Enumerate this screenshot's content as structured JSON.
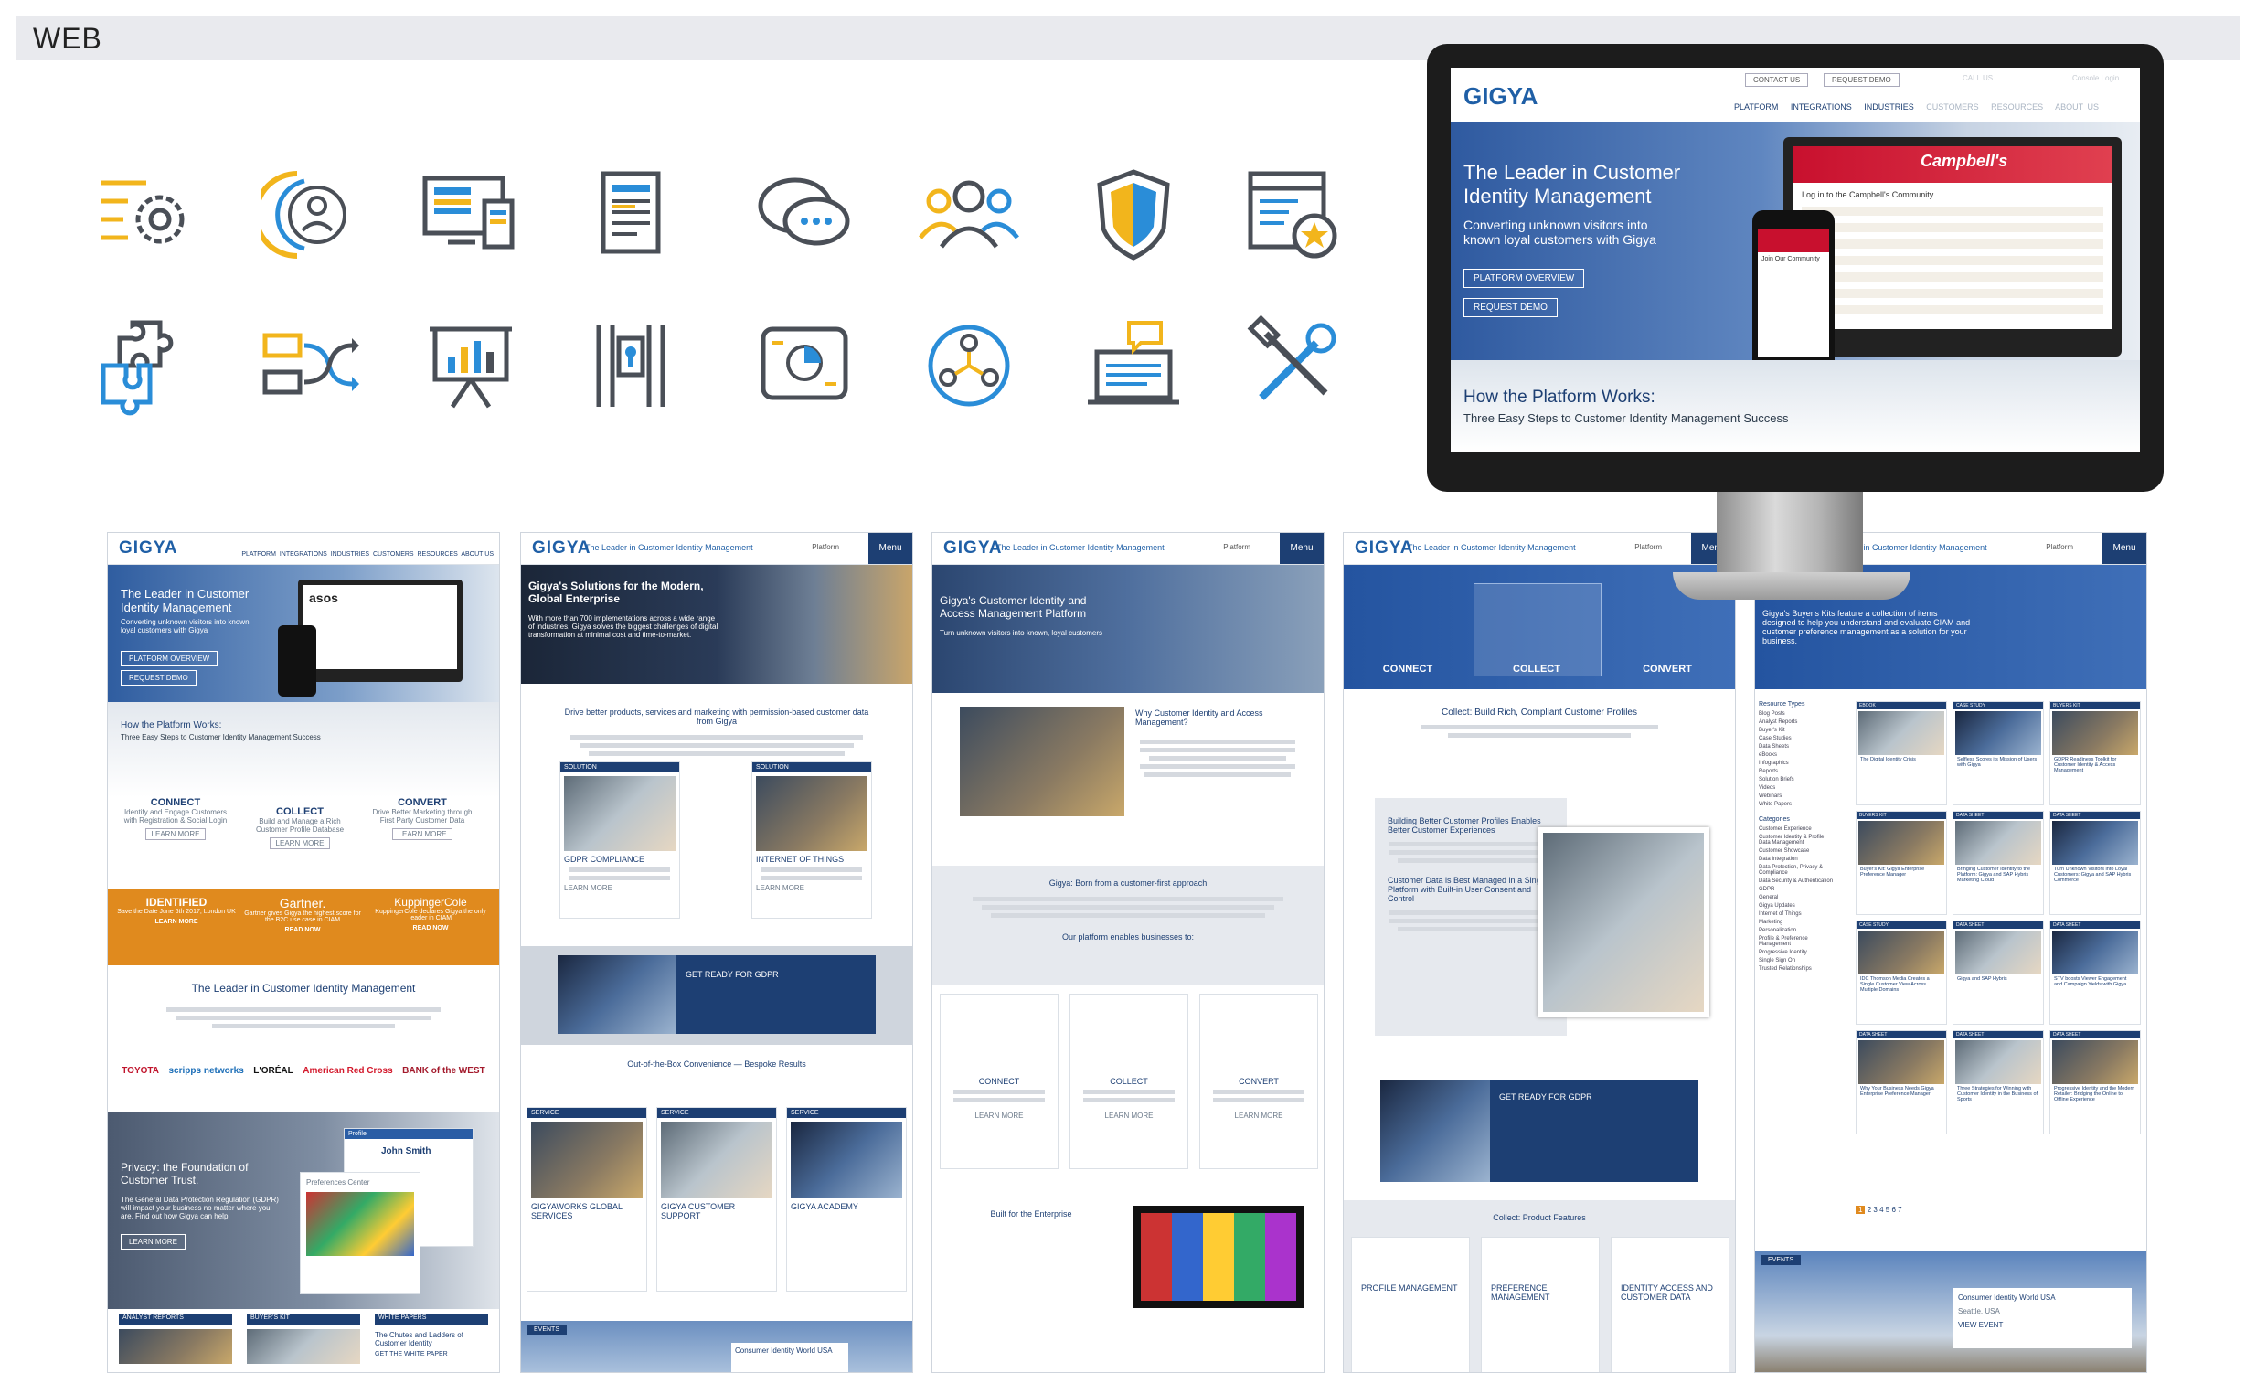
{
  "section_label": "WEB",
  "icons": [
    "settings-lines-icon",
    "user-profile-icon",
    "devices-icon",
    "document-list-icon",
    "chat-bubbles-icon",
    "team-users-icon",
    "shield-icon",
    "browser-star-icon",
    "puzzle-icon",
    "workflow-shuffle-icon",
    "presentation-chart-icon",
    "vault-lock-icon",
    "dashboard-pie-icon",
    "group-network-icon",
    "laptop-chat-icon",
    "tools-icon"
  ],
  "colors": {
    "brand_blue": "#1d3f73",
    "accent_orange": "#e08a1e",
    "icon_gray": "#4a4f57",
    "icon_yellow": "#f2b51c",
    "icon_blue": "#2a8dd8"
  },
  "monitor": {
    "logo": "GIGYA",
    "nav": [
      "PLATFORM",
      "INTEGRATIONS",
      "INDUSTRIES",
      "CUSTOMERS",
      "RESOURCES",
      "ABOUT US"
    ],
    "top_buttons": [
      "CONTACT US",
      "REQUEST DEMO"
    ],
    "call": "CALL US",
    "login": "Console Login",
    "hero_title": "The Leader in Customer Identity Management",
    "hero_sub": "Converting unknown visitors into known loyal customers with Gigya",
    "btn_overview": "PLATFORM OVERVIEW",
    "btn_demo": "REQUEST DEMO",
    "campbells_title": "Log in to the Campbell's Community",
    "phone_text": "Join Our Community",
    "how_title": "How the Platform Works:",
    "how_sub": "Three Easy Steps to Customer Identity Management Success"
  },
  "col1": {
    "logo": "GIGYA",
    "nav": [
      "PLATFORM",
      "INTEGRATIONS",
      "INDUSTRIES",
      "CUSTOMERS",
      "RESOURCES",
      "ABOUT US"
    ],
    "hero_title": "The Leader in Customer Identity Management",
    "hero_sub": "Converting unknown visitors into known loyal customers with Gigya",
    "btn1": "PLATFORM OVERVIEW",
    "btn2": "REQUEST DEMO",
    "asos": "asos",
    "how_title": "How the Platform Works:",
    "how_sub": "Three Easy Steps to Customer Identity Management Success",
    "steps": [
      {
        "title": "CONNECT",
        "text": "Identify and Engage Customers with Registration & Social Login"
      },
      {
        "title": "COLLECT",
        "text": "Build and Manage a Rich Customer Profile Database"
      },
      {
        "title": "CONVERT",
        "text": "Drive Better Marketing through First Party Customer Data"
      }
    ],
    "learn_more": "LEARN MORE",
    "awards": [
      {
        "title": "IDENTIFIED",
        "text": "Save the Date June 6th 2017, London UK",
        "link": "LEARN MORE"
      },
      {
        "title": "Gartner.",
        "text": "Gartner gives Gigya the highest score for the B2C use case in CIAM",
        "link": "READ NOW"
      },
      {
        "title": "KuppingerCole",
        "text": "KuppingerCole declares Gigya the only leader in CIAM",
        "link": "READ NOW"
      }
    ],
    "leader_title": "The Leader in Customer Identity Management",
    "clients": [
      "TOYOTA",
      "scripps networks",
      "L'ORÉAL",
      "American Red Cross",
      "BANK of the WEST"
    ],
    "privacy_title": "Privacy: the Foundation of Customer Trust.",
    "privacy_text": "The General Data Protection Regulation (GDPR) will impact your business no matter where you are. Find out how Gigya can help.",
    "profile_name": "John Smith",
    "profile_label": "Profile",
    "pref_label": "Preferences Center",
    "footer_tabs": [
      "ANALYST REPORTS",
      "BUYER'S KIT",
      "WHITE PAPERS"
    ],
    "wp_title": "The Chutes and Ladders of Customer Identity",
    "wp_link": "GET THE WHITE PAPER"
  },
  "col2": {
    "tag": "The Leader in Customer Identity Management",
    "platform": "Platform",
    "menu": "Menu",
    "hero_title": "Gigya's Solutions for the Modern, Global Enterprise",
    "hero_text": "With more than 700 implementations across a wide range of industries, Gigya solves the biggest challenges of digital transformation at minimal cost and time-to-market.",
    "drive_title": "Drive better products, services and marketing with permission-based customer data from Gigya",
    "sol_label": "SOLUTION",
    "sol1": "GDPR COMPLIANCE",
    "sol2": "INTERNET OF THINGS",
    "learn_more": "LEARN MORE",
    "gdpr_title": "GET READY FOR GDPR",
    "box_title": "Out-of-the-Box Convenience — Bespoke Results",
    "svc_label": "SERVICE",
    "services": [
      "GIGYAWORKS GLOBAL SERVICES",
      "GIGYA CUSTOMER SUPPORT",
      "GIGYA ACADEMY"
    ],
    "events": "EVENTS",
    "event_name": "Consumer Identity World USA"
  },
  "col3": {
    "tag": "The Leader in Customer Identity Management",
    "platform": "Platform",
    "menu": "Menu",
    "hero_title": "Gigya's Customer Identity and Access Management Platform",
    "hero_sub": "Turn unknown visitors into known, loyal customers",
    "why_title": "Why Customer Identity and Access Management?",
    "born_title": "Gigya: Born from a customer-first approach",
    "enables": "Our platform enables businesses to:",
    "features": [
      "CONNECT",
      "COLLECT",
      "CONVERT"
    ],
    "learn_more": "LEARN MORE",
    "built_title": "Built for the Enterprise"
  },
  "col4": {
    "tag": "The Leader in Customer Identity Management",
    "platform": "Platform",
    "menu": "Menu",
    "tabs": [
      "CONNECT",
      "COLLECT",
      "CONVERT"
    ],
    "collect_title": "Collect: Build Rich, Compliant Customer Profiles",
    "side1": "Building Better Customer Profiles Enables Better Customer Experiences",
    "side2": "Customer Data is Best Managed in a Single Platform with Built-in User Consent and Control",
    "gdpr_title": "GET READY FOR GDPR",
    "features_title": "Collect: Product Features",
    "features": [
      "PROFILE MANAGEMENT",
      "PREFERENCE MANAGEMENT",
      "IDENTITY ACCESS AND CUSTOMER DATA"
    ]
  },
  "col5": {
    "tag": "The Leader in Customer Identity Management",
    "platform": "Platform",
    "menu": "Menu",
    "hero_text": "Gigya's Buyer's Kits feature a collection of items designed to help you understand and evaluate CIAM and customer preference management as a solution for your business.",
    "filter_title": "Resource Types",
    "filters": [
      "Blog Posts",
      "Analyst Reports",
      "Buyer's Kit",
      "Case Studies",
      "Data Sheets",
      "eBooks",
      "Infographics",
      "Reports",
      "Solution Briefs",
      "Videos",
      "Webinars",
      "White Papers"
    ],
    "categories_title": "Categories",
    "categories": [
      "Customer Experience",
      "Customer Identity & Profile Data Management",
      "Customer Showcase",
      "Data Integration",
      "Data Protection, Privacy & Compliance",
      "Data Security & Authentication",
      "GDPR",
      "General",
      "Gigya Updates",
      "Internet of Things",
      "Marketing",
      "Personalization",
      "Profile & Preference Management",
      "Progressive Identity",
      "Single Sign On",
      "Trusted Relationships"
    ],
    "card_labels": [
      "EBOOK",
      "CASE STUDY",
      "BUYERS KIT",
      "BUYERS KIT",
      "DATA SHEET",
      "DATA SHEET",
      "CASE STUDY",
      "DATA SHEET",
      "DATA SHEET",
      "DATA SHEET",
      "DATA SHEET",
      "DATA SHEET"
    ],
    "card_titles": [
      "The Digital Identity Crisis",
      "Selfless Scores its Mission of Users with Gigya",
      "GDPR Readiness Toolkit for Customer Identity & Access Management",
      "Buyer's Kit: Gigya Enterprise Preference Manager",
      "Bringing Customer Identity to the Platform: Gigya and SAP Hybris Marketing Cloud",
      "Turn Unknown Visitors into Loyal Customers: Gigya and SAP Hybris Commerce",
      "IDC Thomson Media Creates a Single Customer View Across Multiple Domains",
      "Gigya and SAP Hybris",
      "STV boosts Viewer Engagement and Campaign Yields with Gigya",
      "Why Your Business Needs Gigya Enterprise Preference Manager",
      "Three Strategies for Winning with Customer Identity in the Business of Sports",
      "Progressive Identity and the Modern Retailer: Bridging the Online to Offline Experience"
    ],
    "pagination": [
      "1",
      "2",
      "3",
      "4",
      "5",
      "6",
      "7"
    ],
    "events": "EVENTS",
    "event_name": "Consumer Identity World USA",
    "event_place": "Seattle, USA",
    "event_link": "VIEW EVENT"
  }
}
